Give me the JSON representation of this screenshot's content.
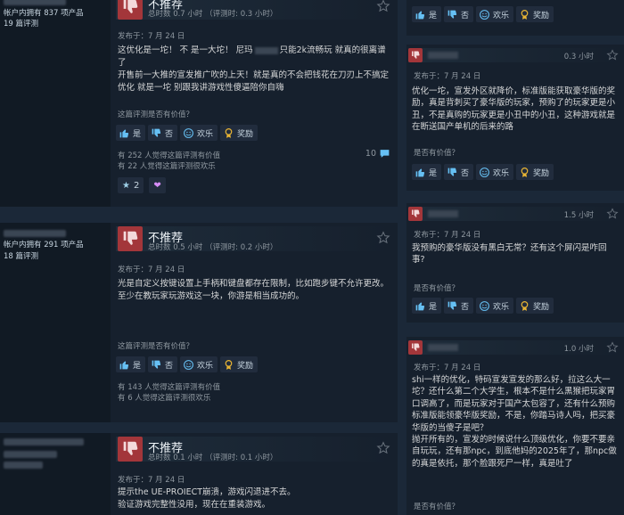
{
  "labels": {
    "not_recommended": "不推荐",
    "helpful_question": "这篇评测是否有价值？",
    "helpful_question_short": "是否有价值？",
    "yes": "是",
    "no": "否",
    "funny": "欢乐",
    "award": "奖励"
  },
  "left_reviews": [
    {
      "owned": "帐户内拥有 837 项产品",
      "reviews": "19 篇评测",
      "hours": "总时数 0.7 小时 （评测时: 0.3 小时）",
      "posted": "发布于：7 月 24 日",
      "lines": [
        "这优化是一坨！ 不 是一大坨！ 尼玛",
        "只能2k流畅玩 就真的很离谱了",
        "开售前一大推的宣发推广吹的上天！就是真的不会把钱花在刀刃上不搞定优化 就是一坨 别跟我讲游戏性傻逼陪你自嗨"
      ],
      "helpful_count": "有 252 人觉得这篇评测有价值",
      "funny_count": "有 22 人觉得这篇评测很欢乐",
      "comments": "10",
      "award_count": "2"
    },
    {
      "owned": "帐户内拥有 291 项产品",
      "reviews": "18 篇评测",
      "hours": "总时数 0.5 小时 （评测时: 0.2 小时）",
      "posted": "发布于：7 月 24 日",
      "p1": "光是自定义按键设置上手柄和键盘都存在限制，比如跑步键不允许更改。",
      "p2": "至少在教玩家玩游戏这一块，你游是相当成功的。",
      "helpful_count": "有 143 人觉得这篇评测有价值",
      "funny_count": "有 6 人觉得这篇评测很欢乐"
    },
    {
      "hours": "总时数 0.1 小时 （评测时: 0.1 小时）",
      "posted": "发布于：7 月 24 日",
      "p1": "提示the UE-PROIECT崩溃，游戏闪退进不去。",
      "p2": "验证游戏完整性没用，现在在重装游戏。"
    }
  ],
  "right_reviews": [
    {
      "hours": "0.3 小时",
      "posted": "发布于：7 月 24 日",
      "text": "优化一坨，宣发外区就降价，标准版能获取豪华版的奖励，真是背刺买了豪华版的玩家，预购了的玩家更是小丑，不是真购的玩家更是小丑中的小丑，这种游戏就是在断送国产单机的后来的路"
    },
    {
      "hours": "1.5 小时",
      "posted": "发布于：7 月 24 日",
      "text": "我预购的豪华版没有黑白无常？还有这个屏闪是咋回事?"
    },
    {
      "hours": "1.0 小时",
      "posted": "发布于：7 月 24 日",
      "p1": "shi一样的优化，特码宣发宣发的那么好，拉这么大一坨？还什么第二个大学生，根本不是什么黑猴把玩家胃口调高了，而是玩家对于国产太包容了，还有什么预购标准版能领豪华版奖励，不是，你踏马诗人吗，把买豪华版的当傻子是吧？",
      "p2": "抛开所有的，宣发的时候说什么顶级优化，你要不要亲自玩玩，还有那npc，到底他妈的2025年了，那npc做的真是依托，那个脸跟死尸一样，真是吐了",
      "q": "是否有价值？"
    }
  ],
  "colors": {
    "thumb_red": "#a3363a",
    "bg": "#1b2838",
    "award_gold": "#e8b434"
  }
}
